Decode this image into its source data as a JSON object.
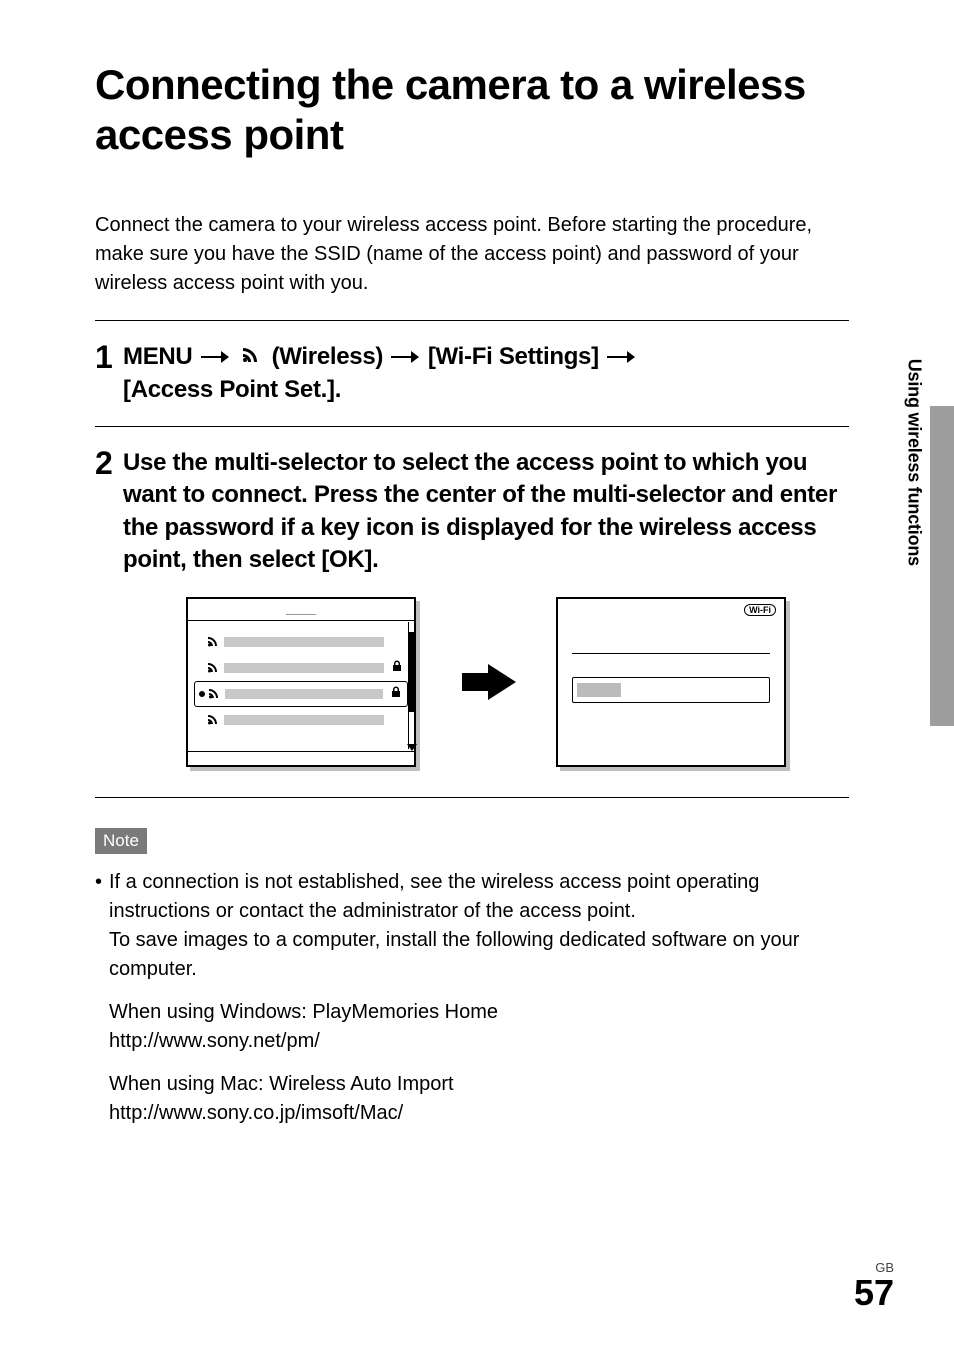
{
  "title": "Connecting the camera to a wireless access point",
  "intro": "Connect the camera to your wireless access point. Before starting the procedure, make sure you have the SSID (name of the access point) and password of your wireless access point with you.",
  "step1": {
    "num": "1",
    "menu_label": "MENU",
    "wireless_label": "(Wireless)",
    "wifi_settings_label": "[Wi-Fi Settings]",
    "access_point_label": "[Access Point Set.]."
  },
  "step2": {
    "num": "2",
    "heading": "Use the multi-selector to select the access point to which you want to connect. Press the center of the multi-selector and enter the password if a key icon is displayed for the wireless access point, then select [OK].",
    "screen_left": {
      "rows": [
        {
          "locked": false,
          "selected": false
        },
        {
          "locked": true,
          "selected": false
        },
        {
          "locked": true,
          "selected": true
        },
        {
          "locked": false,
          "selected": false
        }
      ]
    },
    "screen_right": {
      "wifi_badge": "Wi-Fi"
    }
  },
  "note": {
    "label": "Note",
    "bullet_text": "If a connection is not established, see the wireless access point operating instructions or contact the administrator of the access point.",
    "save_text": "To save images to a computer, install the following dedicated software on your computer.",
    "windows": {
      "line1": "When using Windows: PlayMemories Home",
      "line2": "http://www.sony.net/pm/"
    },
    "mac": {
      "line1": "When using Mac: Wireless Auto Import",
      "line2": "http://www.sony.co.jp/imsoft/Mac/"
    }
  },
  "side_tab": "Using wireless functions",
  "footer": {
    "region": "GB",
    "page": "57"
  },
  "chart_data": {
    "type": "table",
    "title": "Access point list screen (left)",
    "columns": [
      "row_index",
      "has_lock_icon",
      "is_selected"
    ],
    "rows": [
      [
        1,
        false,
        false
      ],
      [
        2,
        true,
        false
      ],
      [
        3,
        true,
        true
      ],
      [
        4,
        false,
        false
      ]
    ]
  }
}
